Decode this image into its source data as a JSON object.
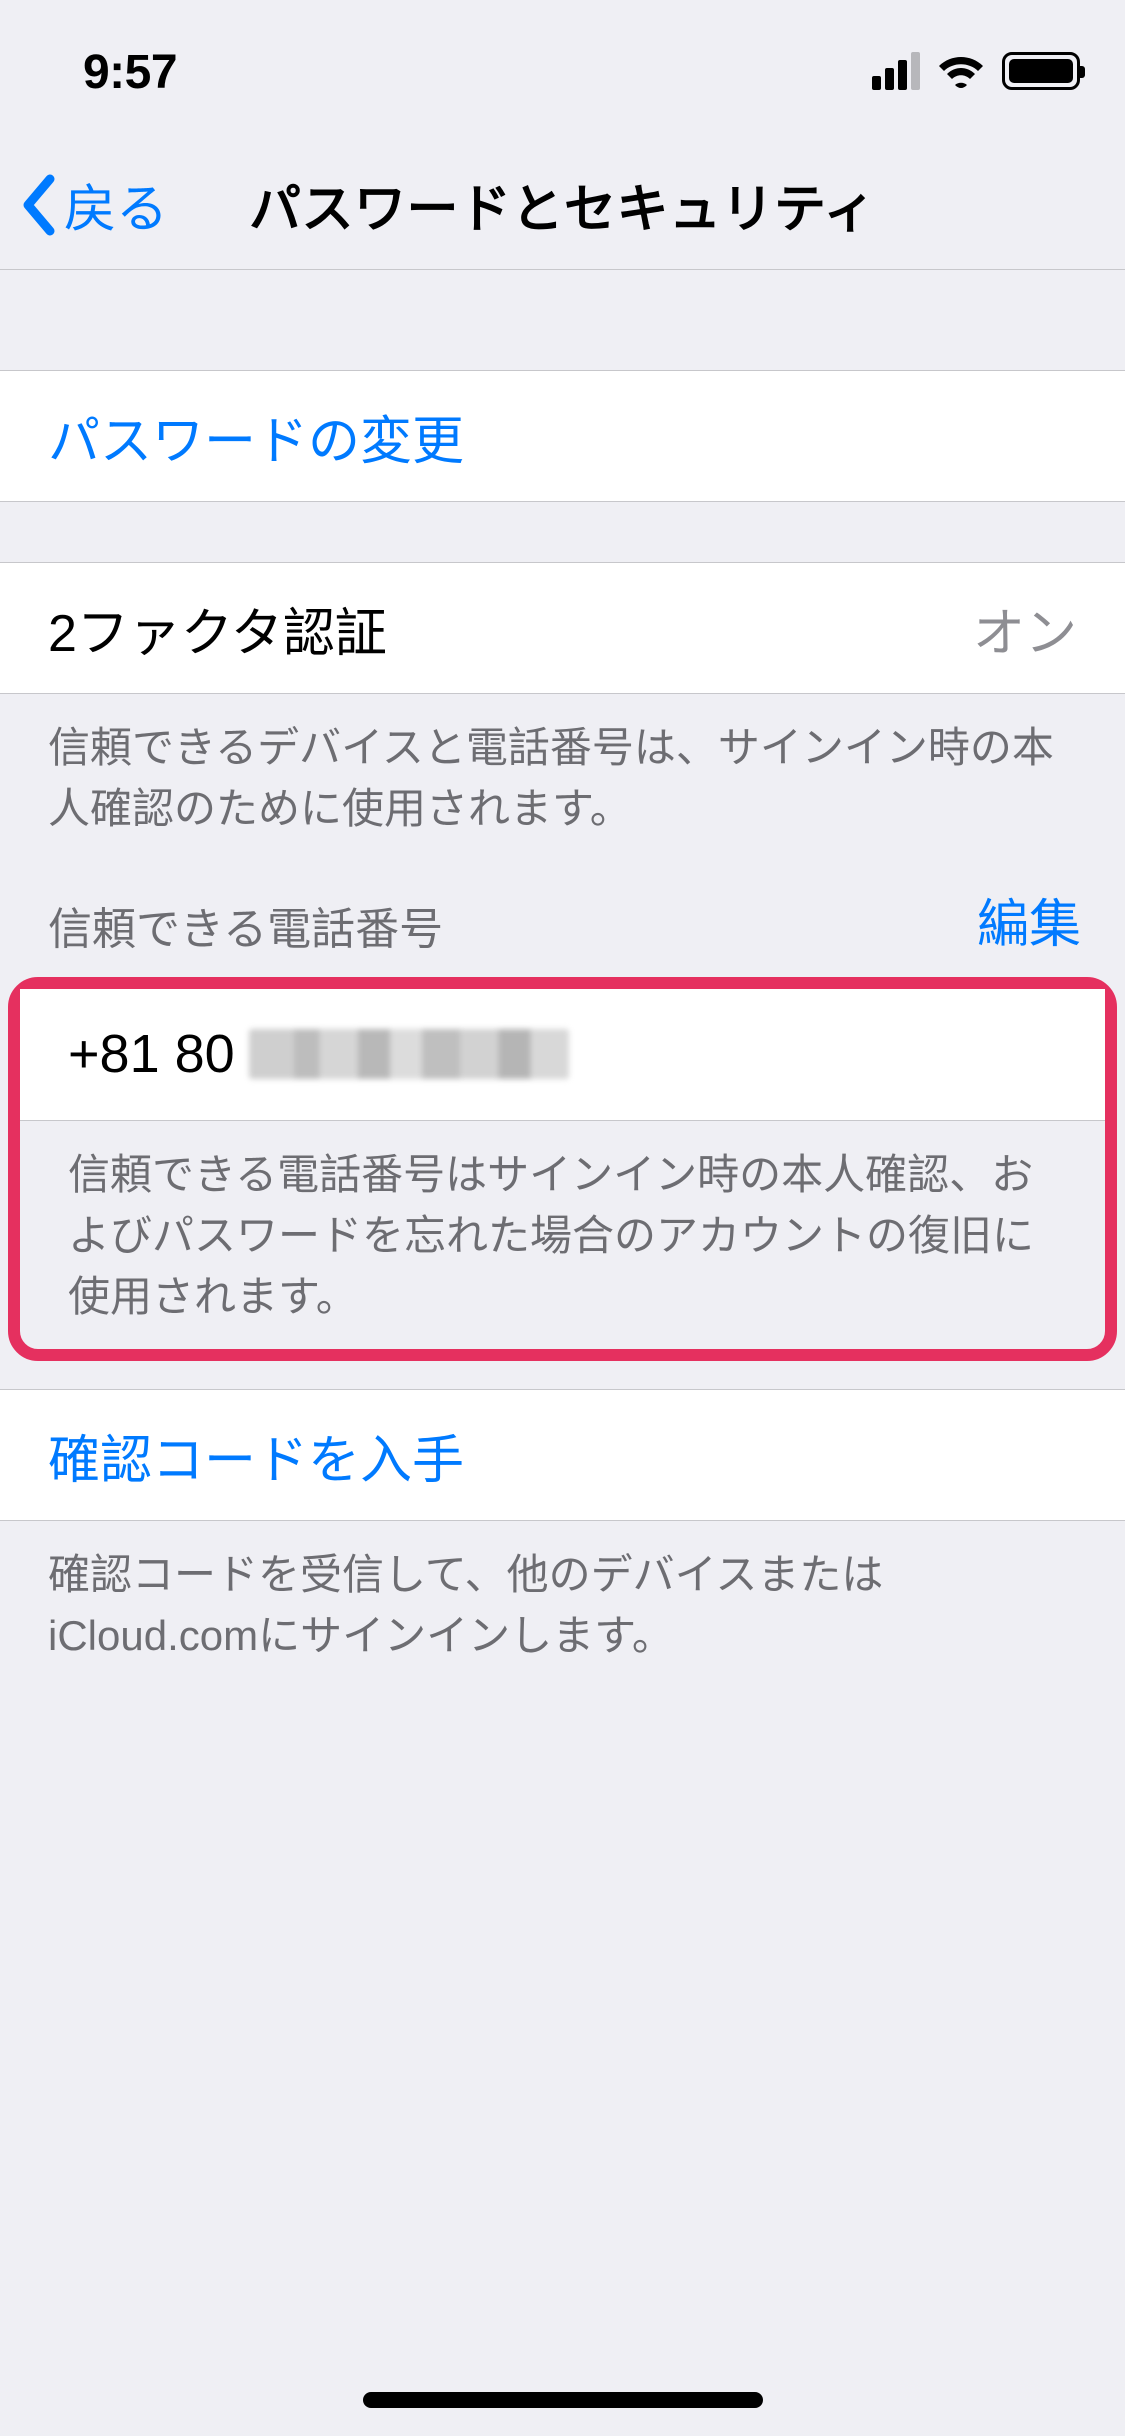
{
  "status": {
    "time": "9:57"
  },
  "nav": {
    "back_label": "戻る",
    "title": "パスワードとセキュリティ"
  },
  "sections": {
    "change_password_label": "パスワードの変更",
    "two_factor": {
      "label": "2ファクタ認証",
      "value": "オン",
      "footer": "信頼できるデバイスと電話番号は、サインイン時の本人確認のために使用されます。"
    },
    "trusted_phone": {
      "header_label": "信頼できる電話番号",
      "edit_label": "編集",
      "phone_prefix": "+81 80",
      "footer": "信頼できる電話番号はサインイン時の本人確認、およびパスワードを忘れた場合のアカウントの復旧に使用されます。"
    },
    "get_code": {
      "label": "確認コードを入手",
      "footer": "確認コードを受信して、他のデバイスまたはiCloud.comにサインインします。"
    }
  }
}
